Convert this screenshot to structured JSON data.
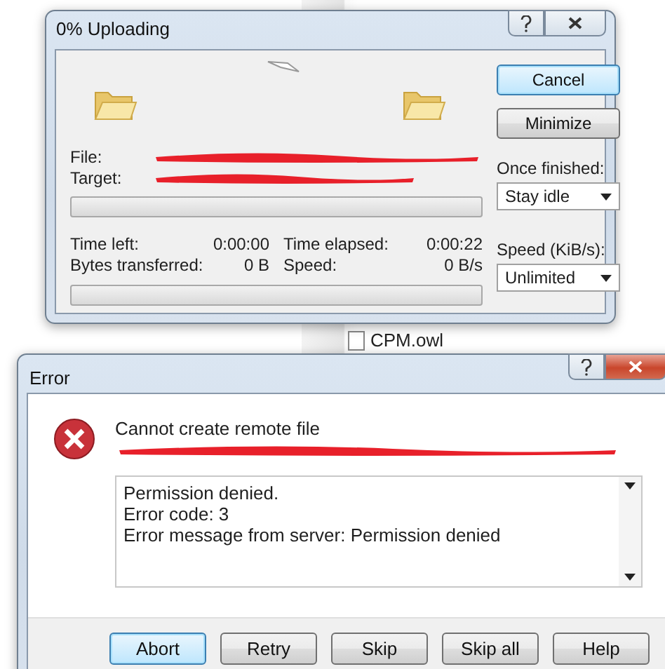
{
  "background_list": {
    "items": [
      "CPM.owl"
    ]
  },
  "upload_dialog": {
    "title": "0% Uploading",
    "file_label": "File:",
    "target_label": "Target:",
    "file_progress": {
      "level": 0
    },
    "stats": [
      {
        "label": "Time left:",
        "value": "0:00:00"
      },
      {
        "label": "Time elapsed:",
        "value": "0:00:22"
      },
      {
        "label": "Bytes transferred:",
        "value": "0 B"
      },
      {
        "label": "Speed:",
        "value": "0 B/s"
      }
    ],
    "total_progress": {
      "level": 0
    },
    "buttons": [
      {
        "label": "Cancel",
        "default": true
      },
      {
        "label": "Minimize",
        "default": false
      }
    ],
    "once_finished": {
      "label": "Once finished:",
      "value": "Stay idle"
    },
    "speed_limit": {
      "label": "Speed (KiB/s):",
      "value": "Unlimited"
    }
  },
  "error_dialog": {
    "title": "Error",
    "heading": "Cannot create remote file",
    "details": [
      "Permission denied.",
      "Error code: 3",
      "Error message from server: Permission denied"
    ],
    "buttons": [
      {
        "label": "Abort",
        "default": true
      },
      {
        "label": "Retry",
        "default": false
      },
      {
        "label": "Skip",
        "default": false
      },
      {
        "label": "Skip all",
        "default": false
      },
      {
        "label": "Help",
        "default": false
      }
    ]
  }
}
